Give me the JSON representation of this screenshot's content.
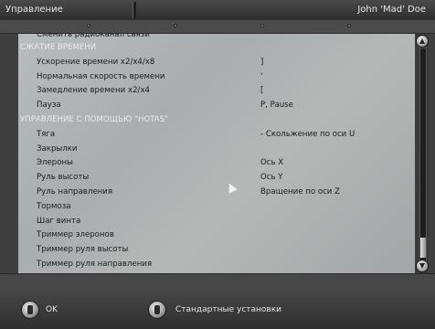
{
  "window": {
    "title": "Управление",
    "user": "John 'Mad' Doe"
  },
  "list": {
    "rows": [
      {
        "label": "Сменить радиоканал связи",
        "value": "",
        "type": "partial"
      },
      {
        "label": "СЖАТИЕ ВРЕМЕНИ",
        "value": "",
        "type": "header"
      },
      {
        "label": "Ускорение времени x2/x4/x8",
        "value": "]",
        "type": "item"
      },
      {
        "label": "Нормальная скорость времени",
        "value": "'",
        "type": "item"
      },
      {
        "label": "Замедление времени x2/x4",
        "value": "[",
        "type": "item"
      },
      {
        "label": "Пауза",
        "value": "P, Pause",
        "type": "item"
      },
      {
        "label": "УПРАВЛЕНИЕ С ПОМОЩЬЮ \"HOTAS\"",
        "value": "",
        "type": "header"
      },
      {
        "label": "Тяга",
        "value": "- Скольжение по оси U",
        "type": "item"
      },
      {
        "label": "Закрылки",
        "value": "",
        "type": "item"
      },
      {
        "label": "Элероны",
        "value": "Ось X",
        "type": "item"
      },
      {
        "label": "Руль высоты",
        "value": "Ось Y",
        "type": "item"
      },
      {
        "label": "Руль направления",
        "value": "Вращение по оси Z",
        "type": "item"
      },
      {
        "label": "Тормоза",
        "value": "",
        "type": "item"
      },
      {
        "label": "Шаг винта",
        "value": "",
        "type": "item"
      },
      {
        "label": "Триммер элеронов",
        "value": "",
        "type": "item"
      },
      {
        "label": "Триммер руля высоты",
        "value": "",
        "type": "item"
      },
      {
        "label": "Триммер руля направления",
        "value": "",
        "type": "item"
      }
    ]
  },
  "scrollbar": {
    "up_icon": "arrow-up-icon",
    "down_icon": "arrow-down-icon"
  },
  "buttons": {
    "ok": "OK",
    "defaults": "Стандартные установки"
  }
}
